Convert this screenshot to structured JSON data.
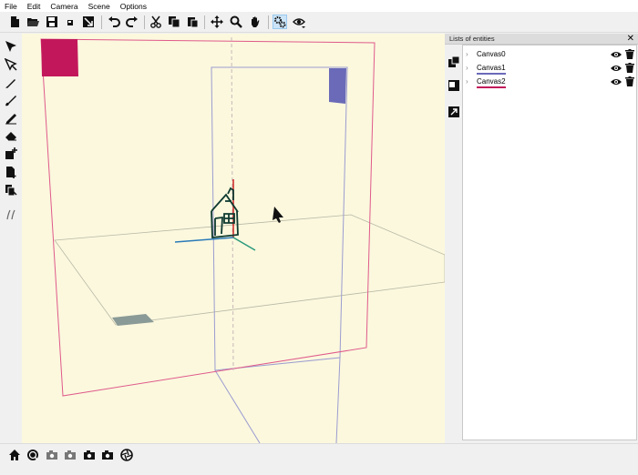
{
  "menu": {
    "file": "File",
    "edit": "Edit",
    "camera": "Camera",
    "scene": "Scene",
    "options": "Options"
  },
  "toolbar": {
    "icons": [
      "new-file-icon",
      "open-folder-icon",
      "save-icon",
      "save-small-icon",
      "export-image-icon",
      "undo-icon",
      "redo-icon",
      "cut-icon",
      "copy-icon",
      "paste-icon",
      "move-icon",
      "zoom-icon",
      "pan-hand-icon",
      "scene-settings-icon",
      "view-mode-icon"
    ],
    "active": "scene-settings-icon"
  },
  "left_tools": [
    "select-arrow-icon",
    "select-sub-arrow-icon",
    "pen-icon",
    "brush-icon",
    "line-pencil-icon",
    "eraser-icon",
    "add-canvas-icon",
    "canvas-from-image-icon",
    "duplicate-canvas-icon",
    "stroke-style-icon"
  ],
  "panel": {
    "title": "Lists of entities",
    "close": "✕",
    "entities": [
      {
        "name": "Canvas0",
        "underline": ""
      },
      {
        "name": "Canvas1",
        "underline": "#6a6ab8"
      },
      {
        "name": "Canvas2",
        "underline": "#c2185b"
      }
    ]
  },
  "side_icons": [
    "copy-entity-icon",
    "paste-entity-icon",
    "resize-entity-icon"
  ],
  "bottom": {
    "icons": [
      "home-icon",
      "camera-reset-icon",
      "camera-1-icon",
      "camera-2-icon",
      "camera-3-icon",
      "camera-4-icon",
      "aperture-icon"
    ]
  },
  "colors": {
    "viewport_bg": "#fbf8de",
    "canvas_pink": "#e05a8a",
    "canvas_purple": "#9c9cd0",
    "marker_magenta": "#c2185b",
    "marker_blue": "#6a6ab8",
    "marker_gray": "#8a9a96"
  }
}
